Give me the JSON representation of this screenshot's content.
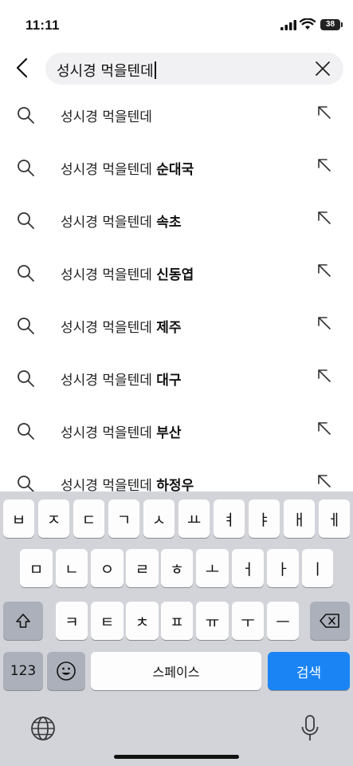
{
  "status_bar": {
    "time": "11:11",
    "battery": "38"
  },
  "search": {
    "query": "성시경 먹을텐데",
    "back_icon": "chevron-left-icon",
    "clear_icon": "close-icon"
  },
  "suggestions": [
    {
      "prefix": "성시경 먹을텐데",
      "suffix": ""
    },
    {
      "prefix": "성시경 먹을텐데 ",
      "suffix": "순대국"
    },
    {
      "prefix": "성시경 먹을텐데 ",
      "suffix": "속초"
    },
    {
      "prefix": "성시경 먹을텐데 ",
      "suffix": "신동엽"
    },
    {
      "prefix": "성시경 먹을텐데 ",
      "suffix": "제주"
    },
    {
      "prefix": "성시경 먹을텐데 ",
      "suffix": "대구"
    },
    {
      "prefix": "성시경 먹을텐데 ",
      "suffix": "부산"
    },
    {
      "prefix": "성시경 먹을텐데 ",
      "suffix": "하정우"
    }
  ],
  "keyboard": {
    "row1": [
      "ㅂ",
      "ㅈ",
      "ㄷ",
      "ㄱ",
      "ㅅ",
      "ㅛ",
      "ㅕ",
      "ㅑ",
      "ㅐ",
      "ㅔ"
    ],
    "row2": [
      "ㅁ",
      "ㄴ",
      "ㅇ",
      "ㄹ",
      "ㅎ",
      "ㅗ",
      "ㅓ",
      "ㅏ",
      "ㅣ"
    ],
    "row3": [
      "ㅋ",
      "ㅌ",
      "ㅊ",
      "ㅍ",
      "ㅠ",
      "ㅜ",
      "ㅡ"
    ],
    "numbers_label": "123",
    "space_label": "스페이스",
    "search_label": "검색",
    "accent": "#1a84f5"
  }
}
